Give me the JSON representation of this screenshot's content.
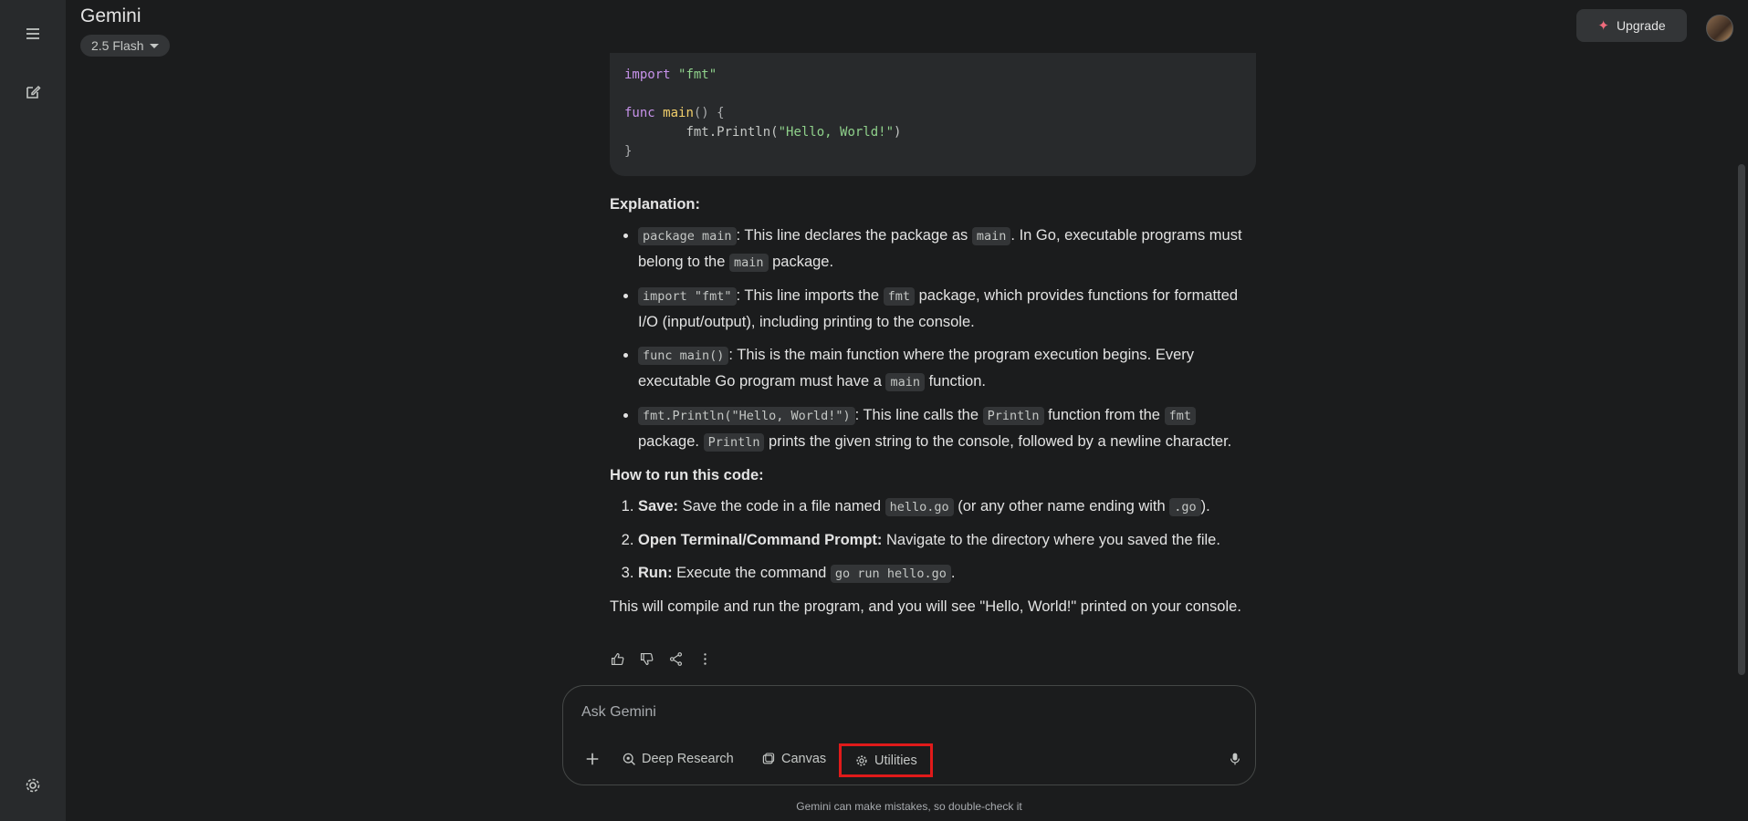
{
  "app": {
    "title": "Gemini",
    "model": "2.5 Flash",
    "upgrade_label": "Upgrade"
  },
  "code": {
    "line1_kw": "import",
    "line1_str": "\"fmt\"",
    "line3_kw": "func",
    "line3_fn": "main",
    "line3_rest": "() {",
    "line4_call": "fmt.Println(",
    "line4_str": "\"Hello, World!\"",
    "line4_close": ")",
    "line5": "}"
  },
  "explanation": {
    "heading": "Explanation:",
    "items": [
      {
        "code": "package main",
        "t1": ": This line declares the package as ",
        "code2": "main",
        "t2": ". In Go, executable programs must belong to the ",
        "code3": "main",
        "t3": " package."
      },
      {
        "code": "import \"fmt\"",
        "t1": ": This line imports the ",
        "code2": "fmt",
        "t2": " package, which provides functions for formatted I/O (input/output), including printing to the console."
      },
      {
        "code": "func main()",
        "t1": ": This is the main function where the program execution begins. Every executable Go program must have a ",
        "code2": "main",
        "t2": " function."
      },
      {
        "code": "fmt.Println(\"Hello, World!\")",
        "t1": ": This line calls the ",
        "code2": "Println",
        "t2": " function from the ",
        "code3": "fmt",
        "t3": " package. ",
        "code4": "Println",
        "t4": " prints the given string to the console, followed by a newline character."
      }
    ]
  },
  "run": {
    "heading": "How to run this code:",
    "steps": [
      {
        "label": "Save:",
        "t1": " Save the code in a file named ",
        "code": "hello.go",
        "t2": " (or any other name ending with ",
        "code2": ".go",
        "t3": ")."
      },
      {
        "label": "Open Terminal/Command Prompt:",
        "t1": " Navigate to the directory where you saved the file."
      },
      {
        "label": "Run:",
        "t1": " Execute the command ",
        "code": "go run hello.go",
        "t2": "."
      }
    ]
  },
  "conclusion": "This will compile and run the program, and you will see \"Hello, World!\" printed on your console.",
  "input": {
    "placeholder": "Ask Gemini",
    "tools": {
      "deep_research": "Deep Research",
      "canvas": "Canvas",
      "utilities": "Utilities"
    }
  },
  "disclaimer": "Gemini can make mistakes, so double-check it",
  "colors": {
    "highlight": "#e01a1a",
    "upgrade_spark": "#f06b7c",
    "background": "#1b1c1d"
  }
}
